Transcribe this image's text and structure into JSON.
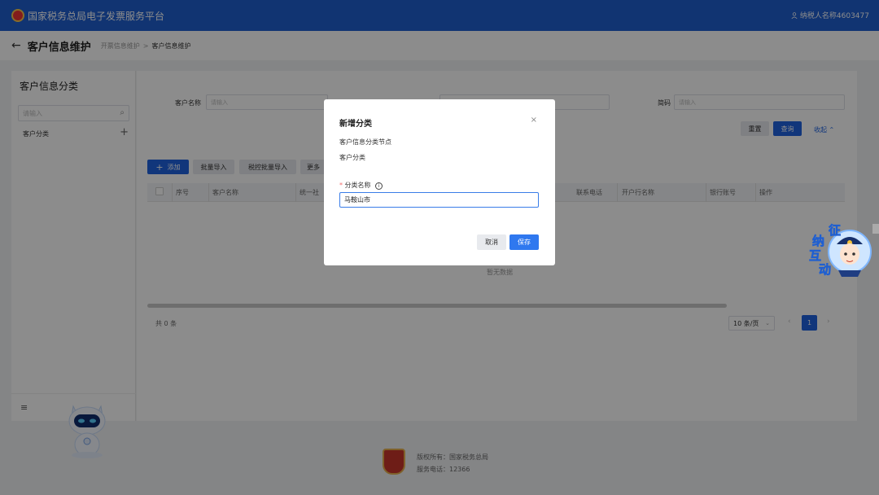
{
  "header": {
    "site_title": "国家税务总局电子发票服务平台",
    "user_label": "纳税人名称4603477"
  },
  "breadcrumb": {
    "page_title": "客户信息维护",
    "parent": "开票信息维护",
    "separator": ">",
    "current": "客户信息维护"
  },
  "sidebar": {
    "title": "客户信息分类",
    "search_placeholder": "请输入",
    "tree_items": [
      {
        "label": "客户分类"
      }
    ]
  },
  "filters": {
    "customer_name_label": "客户名称",
    "customer_name_placeholder": "请输入",
    "short_code_label": "简码",
    "short_code_placeholder": "请输入",
    "reset_label": "重置",
    "query_label": "查询",
    "collapse_label": "收起"
  },
  "toolbar": {
    "add_label": "添加",
    "batch_import_label": "批量导入",
    "smart_batch_import_label": "税控批量导入",
    "more_label": "更多"
  },
  "table": {
    "columns": [
      "序号",
      "客户名称",
      "统一社",
      "联系电话",
      "开户行名称",
      "银行账号",
      "操作"
    ],
    "empty_text": "暂无数据"
  },
  "pagination": {
    "total_text": "共 0 条",
    "page_size": "10 条/页",
    "current_page": "1",
    "prev": "‹",
    "next": "›"
  },
  "footer": {
    "copyright": "版权所有：国家税务总局",
    "service_phone": "服务电话：12366"
  },
  "dialog": {
    "title": "新增分类",
    "close": "×",
    "node_label": "客户信息分类节点",
    "node_value": "客户分类",
    "required_mark": "*",
    "field_label": "分类名称",
    "field_value": "马鞍山市",
    "cancel_label": "取消",
    "save_label": "保存"
  },
  "widget": {
    "chars": [
      "征",
      "纳",
      "互",
      "动"
    ]
  },
  "colors": {
    "brand": "#1f5fd0",
    "primary_button": "#2f78ef"
  }
}
